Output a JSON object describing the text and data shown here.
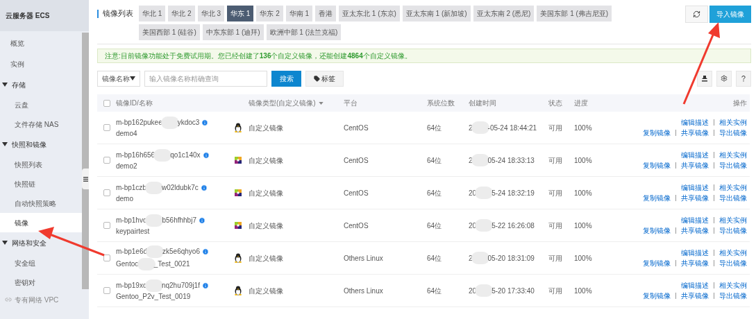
{
  "sidebar": {
    "title": "云服务器 ECS",
    "items": [
      {
        "label": "概览",
        "kind": "item",
        "selected": false
      },
      {
        "label": "实例",
        "kind": "item",
        "selected": false
      },
      {
        "label": "存储",
        "kind": "group",
        "expanded": true,
        "children": [
          {
            "label": "云盘",
            "selected": false
          },
          {
            "label": "文件存储 NAS",
            "selected": false
          }
        ]
      },
      {
        "label": "快照和镜像",
        "kind": "group",
        "expanded": true,
        "children": [
          {
            "label": "快照列表",
            "selected": false
          },
          {
            "label": "快照链",
            "selected": false
          },
          {
            "label": "自动快照策略",
            "selected": false
          },
          {
            "label": "镜像",
            "selected": true
          }
        ]
      },
      {
        "label": "网络和安全",
        "kind": "group",
        "expanded": true,
        "children": [
          {
            "label": "安全组",
            "selected": false
          },
          {
            "label": "密钥对",
            "selected": false
          }
        ]
      },
      {
        "label": "专有网络 VPC",
        "kind": "link",
        "selected": false
      }
    ]
  },
  "page_title": "镜像列表",
  "regions": [
    {
      "label": "华北 1",
      "selected": false
    },
    {
      "label": "华北 2",
      "selected": false
    },
    {
      "label": "华北 3",
      "selected": false
    },
    {
      "label": "华东 1",
      "selected": true
    },
    {
      "label": "华东 2",
      "selected": false
    },
    {
      "label": "华南 1",
      "selected": false
    },
    {
      "label": "香港",
      "selected": false
    },
    {
      "label": "亚太东北 1 (东京)",
      "selected": false
    },
    {
      "label": "亚太东南 1 (新加坡)",
      "selected": false
    },
    {
      "label": "亚太东南 2 (悉尼)",
      "selected": false
    },
    {
      "label": "美国东部 1 (弗吉尼亚)",
      "selected": false
    },
    {
      "label": "美国西部 1 (硅谷)",
      "selected": false
    },
    {
      "label": "中东东部 1 (迪拜)",
      "selected": false
    },
    {
      "label": "欧洲中部 1 (法兰克福)",
      "selected": false
    }
  ],
  "import_button": "导入镜像",
  "notice": "注意:目前镜像功能处于免费试用期。您已经创建了**136**个自定义镜像，还能创建**4864**个自定义镜像。",
  "search": {
    "filter": "镜像名称",
    "placeholder": "输入镜像名称精确查询",
    "button": "搜索",
    "tag_button": "标签"
  },
  "table": {
    "select_all": {
      "checked": false
    },
    "columns": [
      "镜像ID/名称",
      "镜像类型(自定义镜像)",
      "平台",
      "系统位数",
      "创建时间",
      "状态",
      "进度",
      "操作"
    ],
    "rows": [
      {
        "checked": false,
        "id": [
          "m-bp162pukee",
          "ykdoc3"
        ],
        "name": [
          "demo4"
        ],
        "kind": "penguin",
        "type": "自定义镜像",
        "platform": "CentOS",
        "bits": "64位",
        "created": [
          "2",
          "-05-24 18:44:21"
        ],
        "status": "可用",
        "progress": "100%",
        "actions": [
          "编辑描述",
          "相关实例",
          "复制镜像",
          "共享镜像",
          "导出镜像"
        ]
      },
      {
        "checked": false,
        "id": [
          "m-bp16h656",
          "qo1c140x"
        ],
        "name": [
          "demo2"
        ],
        "kind": "flower",
        "type": "自定义镜像",
        "platform": "CentOS",
        "bits": "64位",
        "created": [
          "2",
          "05-24 18:33:13"
        ],
        "status": "可用",
        "progress": "100%",
        "actions": [
          "编辑描述",
          "相关实例",
          "复制镜像",
          "共享镜像",
          "导出镜像"
        ]
      },
      {
        "checked": false,
        "id": [
          "m-bp1czb",
          "w02ldubk7c"
        ],
        "name": [
          "demo"
        ],
        "kind": "flower",
        "type": "自定义镜像",
        "platform": "CentOS",
        "bits": "64位",
        "created": [
          "20",
          "5-24 18:32:19"
        ],
        "status": "可用",
        "progress": "100%",
        "actions": [
          "编辑描述",
          "相关实例",
          "复制镜像",
          "共享镜像",
          "导出镜像"
        ]
      },
      {
        "checked": false,
        "id": [
          "m-bp1hvo",
          "b56hfhhbj7"
        ],
        "name": [
          "keypairtest"
        ],
        "kind": "flower",
        "type": "自定义镜像",
        "platform": "CentOS",
        "bits": "64位",
        "created": [
          "20",
          "5-22 16:26:08"
        ],
        "status": "可用",
        "progress": "100%",
        "actions": [
          "编辑描述",
          "相关实例",
          "复制镜像",
          "共享镜像",
          "导出镜像"
        ]
      },
      {
        "checked": false,
        "id": [
          "m-bp1e6d",
          "zk5e6qhyo6"
        ],
        "name": [
          "Gentoo",
          "_Test_0021"
        ],
        "kind": "penguin",
        "type": "自定义镜像",
        "platform": "Others Linux",
        "bits": "64位",
        "created": [
          "2",
          "05-20 18:31:09"
        ],
        "status": "可用",
        "progress": "100%",
        "actions": [
          "编辑描述",
          "相关实例",
          "复制镜像",
          "共享镜像",
          "导出镜像"
        ]
      },
      {
        "checked": false,
        "id": [
          "m-bp19xc",
          "nq2hu709j1f"
        ],
        "name": [
          "Gentoo_P2v_Test_0019"
        ],
        "kind": "penguin",
        "type": "自定义镜像",
        "platform": "Others Linux",
        "bits": "64位",
        "created": [
          "20",
          "5-20 17:33:40"
        ],
        "status": "可用",
        "progress": "100%",
        "actions": [
          "编辑描述",
          "相关实例",
          "复制镜像",
          "共享镜像",
          "导出镜像"
        ]
      }
    ]
  }
}
